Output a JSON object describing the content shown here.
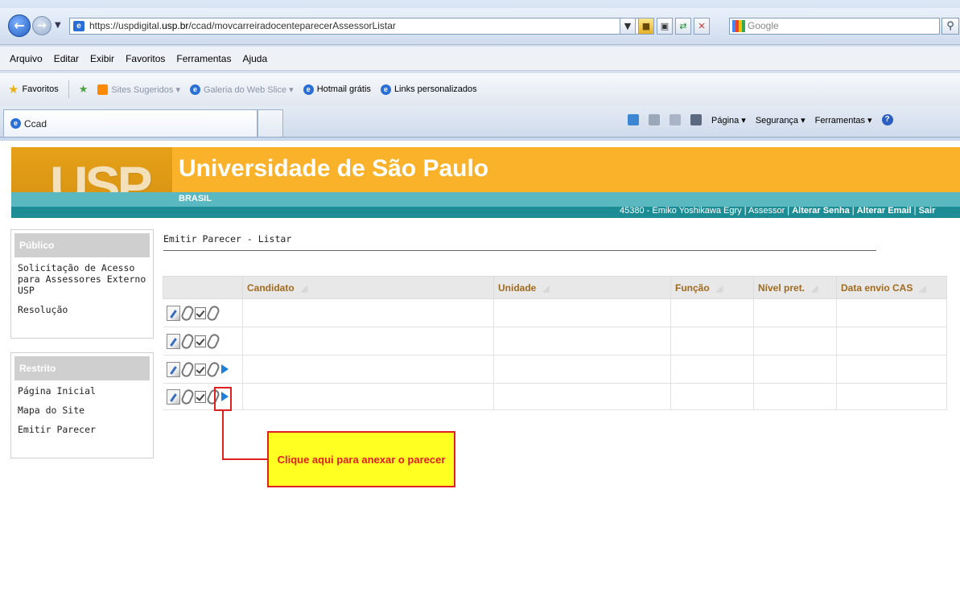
{
  "browser": {
    "url_prefix": "https://uspdigital.",
    "url_domain": "usp.br",
    "url_path": "/ccad/movcarreiradocenteparecerAssessorListar",
    "search_placeholder": "Google",
    "menu": [
      "Arquivo",
      "Editar",
      "Exibir",
      "Favoritos",
      "Ferramentas",
      "Ajuda"
    ],
    "favorites_label": "Favoritos",
    "favorites": [
      "Sites Sugeridos ▾",
      "Galeria do Web Slice ▾",
      "Hotmail grátis",
      "Links personalizados"
    ],
    "tab_title": "Ccad",
    "commands": [
      "Página ▾",
      "Segurança ▾",
      "Ferramentas ▾"
    ]
  },
  "header": {
    "logo_text": "USP",
    "title": "Universidade de São Paulo",
    "subtitle": "BRASIL",
    "user_info": "45380 - Emiko Yoshikawa Egry | Assessor | ",
    "link_change_password": "Alterar Senha",
    "link_change_email": "Alterar Email",
    "link_logout": "Sair",
    "separator": " | "
  },
  "sidebar": {
    "public_title": "Público",
    "public_items": [
      "Solicitação de Acesso para Assessores Externo USP",
      "Resolução"
    ],
    "restricted_title": "Restrito",
    "restricted_items": [
      "Página Inicial",
      "Mapa do Site",
      "Emitir Parecer"
    ]
  },
  "main": {
    "breadcrumb": "Emitir Parecer - Listar",
    "columns": [
      "Candidato",
      "Unidade",
      "Função",
      "Nível pret.",
      "Data envio CAS"
    ],
    "rows": [
      {
        "candidato": "",
        "unidade": "",
        "funcao": "",
        "nivel": "",
        "data_envio": ""
      },
      {
        "candidato": "",
        "unidade": "",
        "funcao": "",
        "nivel": "",
        "data_envio": ""
      },
      {
        "candidato": "",
        "unidade": "",
        "funcao": "",
        "nivel": "",
        "data_envio": ""
      },
      {
        "candidato": "",
        "unidade": "",
        "funcao": "",
        "nivel": "",
        "data_envio": ""
      }
    ]
  },
  "callout": {
    "text": "Clique aqui para anexar o parecer"
  },
  "colors": {
    "usp_orange": "#f9b22a",
    "usp_teal": "#1d8d95",
    "callout_bg": "#ffff22",
    "callout_border": "#e02020"
  }
}
